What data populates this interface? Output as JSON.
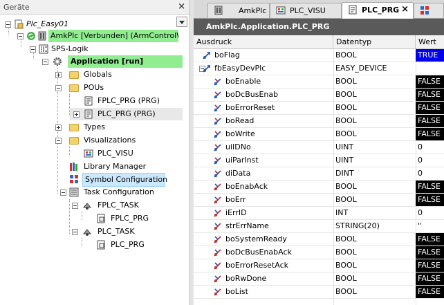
{
  "left_panel": {
    "title": "Geräte",
    "close_glyph": "×",
    "tree": {
      "project": "Plc_Easy01",
      "device": "AmkPlc [Verbunden] (ArmControlWit",
      "sps_logic": "SPS-Logik",
      "application": "Application [run]",
      "globals": "Globals",
      "pous": "POUs",
      "fplc_prg": "FPLC_PRG (PRG)",
      "plc_prg": "PLC_PRG (PRG)",
      "types": "Types",
      "visualizations": "Visualizations",
      "plc_visu": "PLC_VISU",
      "library_manager": "Library Manager",
      "symbol_configuration": "Symbol Configuration",
      "task_configuration": "Task Configuration",
      "fplc_task": "FPLC_TASK",
      "fplc_task_prg": "FPLC_PRG",
      "plc_task": "PLC_TASK",
      "plc_task_prg": "PLC_PRG"
    }
  },
  "tabs": [
    {
      "label": "AmkPlc",
      "icon": "device-icon"
    },
    {
      "label": "PLC_VISU",
      "icon": "visualization-icon"
    },
    {
      "label": "PLC_PRG",
      "icon": "pou-icon",
      "close": "×"
    },
    {
      "label": "",
      "icon": "overflow-icon"
    }
  ],
  "monitor": {
    "title": "AmkPlc.Application.PLC_PRG",
    "columns": {
      "expression": "Ausdruck",
      "type": "Datentyp",
      "value": "Wert"
    },
    "rows": [
      {
        "name": "boFlag",
        "type": "BOOL",
        "value": "TRUE"
      },
      {
        "name": "fbEasyDevPlc",
        "type": "EASY_DEVICE",
        "value": ""
      },
      {
        "name": "boEnable",
        "type": "BOOL",
        "value": "FALSE"
      },
      {
        "name": "boDcBusEnab",
        "type": "BOOL",
        "value": "FALSE"
      },
      {
        "name": "boErrorReset",
        "type": "BOOL",
        "value": "FALSE"
      },
      {
        "name": "boRead",
        "type": "BOOL",
        "value": "FALSE"
      },
      {
        "name": "boWrite",
        "type": "BOOL",
        "value": "FALSE"
      },
      {
        "name": "uiIDNo",
        "type": "UINT",
        "value": "0"
      },
      {
        "name": "uiParInst",
        "type": "UINT",
        "value": "0"
      },
      {
        "name": "diData",
        "type": "DINT",
        "value": "0"
      },
      {
        "name": "boEnabAck",
        "type": "BOOL",
        "value": "FALSE"
      },
      {
        "name": "boErr",
        "type": "BOOL",
        "value": "FALSE"
      },
      {
        "name": "iErrID",
        "type": "INT",
        "value": "0"
      },
      {
        "name": "strErrName",
        "type": "STRING(20)",
        "value": "''"
      },
      {
        "name": "boSystemReady",
        "type": "BOOL",
        "value": "FALSE"
      },
      {
        "name": "boDcBusEnabAck",
        "type": "BOOL",
        "value": "FALSE"
      },
      {
        "name": "boErrorResetAck",
        "type": "BOOL",
        "value": "FALSE"
      },
      {
        "name": "boRwDone",
        "type": "BOOL",
        "value": "FALSE"
      },
      {
        "name": "boList",
        "type": "BOOL",
        "value": "FALSE"
      }
    ]
  },
  "colors": {
    "true_bg": "#0000ee",
    "false_bg": "#000000",
    "connected_bg": "#90ee90",
    "title_bg": "#5a5a5a"
  }
}
